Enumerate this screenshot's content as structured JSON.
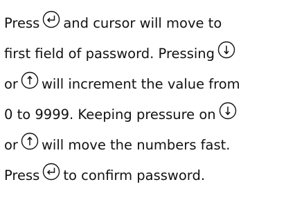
{
  "icons": {
    "enter": "enter-key-icon",
    "down": "down-arrow-key-icon",
    "up": "up-arrow-key-icon"
  },
  "colors": {
    "text": "#111111",
    "icon_stroke": "#111111"
  },
  "lines": [
    {
      "before": "Press",
      "after": "and cursor will move to"
    },
    {
      "before": "first field of password. Pressing",
      "after": ""
    },
    {
      "before": "or",
      "after": "will increment the value from"
    },
    {
      "before": "0 to 9999. Keeping pressure on",
      "after": ""
    },
    {
      "before": "or",
      "after": "will move the numbers fast."
    },
    {
      "before": "Press",
      "after": "to confirm password."
    }
  ]
}
